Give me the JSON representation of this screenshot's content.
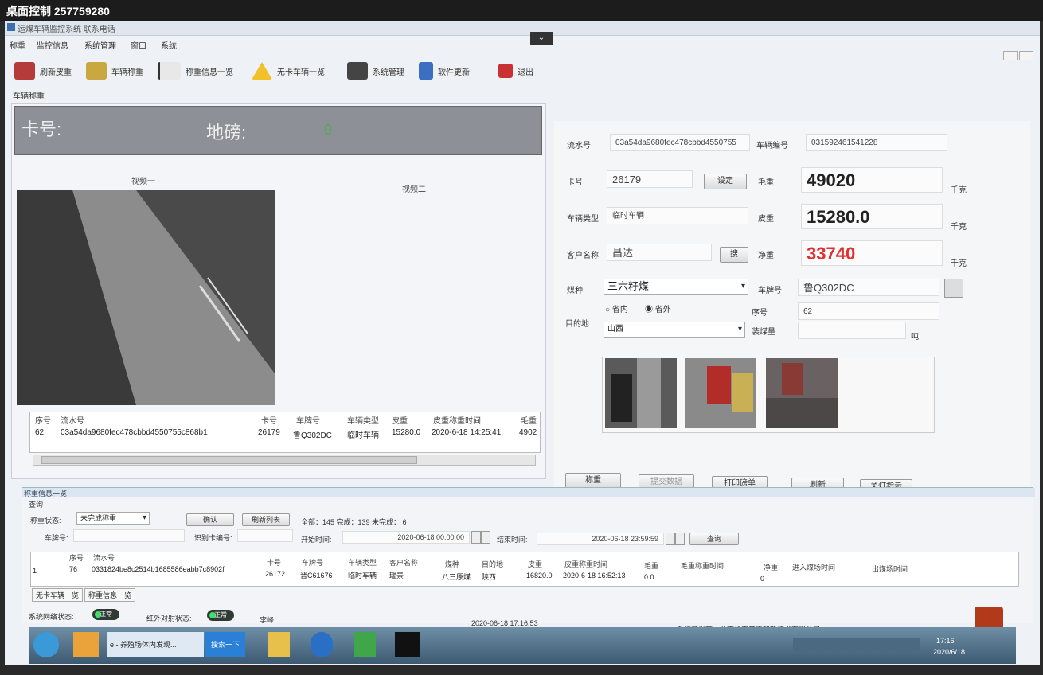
{
  "remote": {
    "title": "桌面控制 257759280"
  },
  "app": {
    "title": "运煤车辆监控系统 联系电话"
  },
  "menu": [
    "称重",
    "监控信息",
    "系统管理",
    "窗口",
    "系统"
  ],
  "toolbar": [
    {
      "label": "刷新皮重",
      "icon": "truck-icon"
    },
    {
      "label": "车辆称重",
      "icon": "scale-truck-icon"
    },
    {
      "label": "称重信息一览",
      "icon": "checkmark-icon"
    },
    {
      "label": "无卡车辆一览",
      "icon": "warning-icon"
    },
    {
      "label": "系统管理",
      "icon": "monitor-icon"
    },
    {
      "label": "软件更新",
      "icon": "update-icon"
    },
    {
      "label": "退出",
      "icon": "exit-icon"
    }
  ],
  "tab": {
    "active": "车辆称重"
  },
  "scale": {
    "card_label": "卡号:",
    "scale_label": "地磅:",
    "value": "0"
  },
  "video": {
    "label1": "视频一",
    "label2": "视频二"
  },
  "record_table": {
    "headers": [
      "序号",
      "流水号",
      "卡号",
      "车牌号",
      "车辆类型",
      "皮重",
      "皮重称重时间",
      "毛重"
    ],
    "row": [
      "62",
      "03a54da9680fec478cbbd4550755c868b1",
      "26179",
      "鲁Q302DC",
      "临时车辆",
      "15280.0",
      "2020-6-18 14:25:41",
      "4902"
    ]
  },
  "form": {
    "serial_label": "流水号",
    "serial_value": "03a54da9680fec478cbbd4550755",
    "vehicle_no_label": "车辆编号",
    "vehicle_no_value": "031592461541228",
    "card_label": "卡号",
    "card_value": "26179",
    "set_button": "设定",
    "gross_label": "毛重",
    "gross_value": "49020",
    "unit1": "千克",
    "type_label": "车辆类型",
    "type_value": "临时车辆",
    "tare_label": "皮重",
    "tare_value": "15280.0",
    "unit2": "千克",
    "customer_label": "客户名称",
    "customer_value": "昌达",
    "customer_button": "搜",
    "net_label": "净重",
    "net_value": "33740",
    "unit3": "千克",
    "coal_label": "煤种",
    "coal_value": "三六籽煤",
    "plate_label": "车牌号",
    "plate_value": "鲁Q302DC",
    "radio_in": "省内",
    "radio_out": "省外",
    "seq_label": "序号",
    "seq_value": "62",
    "dest_label": "目的地",
    "dest_value": "山西",
    "load_label": "装煤量",
    "load_unit": "吨"
  },
  "actions": [
    "称重",
    "提交数据",
    "打印磅单",
    "刷新",
    "关灯指示"
  ],
  "bottom": {
    "title": "称重信息一览",
    "query_label": "查询",
    "status_label": "称重状态:",
    "status_value": "未完成称重",
    "confirm_button": "确认",
    "refresh_button": "刷新列表",
    "summary": "全部：145 完成：139 未完成： 6",
    "plate_label": "车牌号:",
    "card_label": "识别卡编号:",
    "start_label": "开始时间:",
    "start_value": "2020-06-18 00:00:00",
    "end_label": "结束时间:",
    "end_value": "2020-06-18 23:59:59",
    "search_button": "查询",
    "headers": [
      "序号",
      "流水号",
      "卡号",
      "车牌号",
      "车辆类型",
      "客户名称",
      "煤种",
      "目的地",
      "皮重",
      "皮重称重时间",
      "毛重",
      "毛重称重时间",
      "净重",
      "进入煤场时间",
      "出煤场时间"
    ],
    "row": [
      "76",
      "0331824be8c2514b1685586eabb7c8902f",
      "26172",
      "晋C61676",
      "临时车辆",
      "瑞景",
      "八三原煤",
      "陕西",
      "16820.0",
      "2020-6-18 16:52:13",
      "0.0",
      "",
      "0",
      "",
      ""
    ],
    "row_index": "1",
    "tabs": [
      "无卡车辆一览",
      "称重信息一览"
    ]
  },
  "status": {
    "net_label": "系统网络状态:",
    "net_pill": "正常",
    "ir_label": "红外对射状态:",
    "ir_pill": "正常",
    "extra": "李峰",
    "datetime": "2020-06-18 17:16:53",
    "developer": "系统开发商：北京华安普惠智新技术有限公司"
  },
  "taskbar": {
    "browser_label": "e - 养殖场体内发现...",
    "search_label": "搜索一下",
    "clock_time": "17:16",
    "clock_date": "2020/6/18"
  }
}
